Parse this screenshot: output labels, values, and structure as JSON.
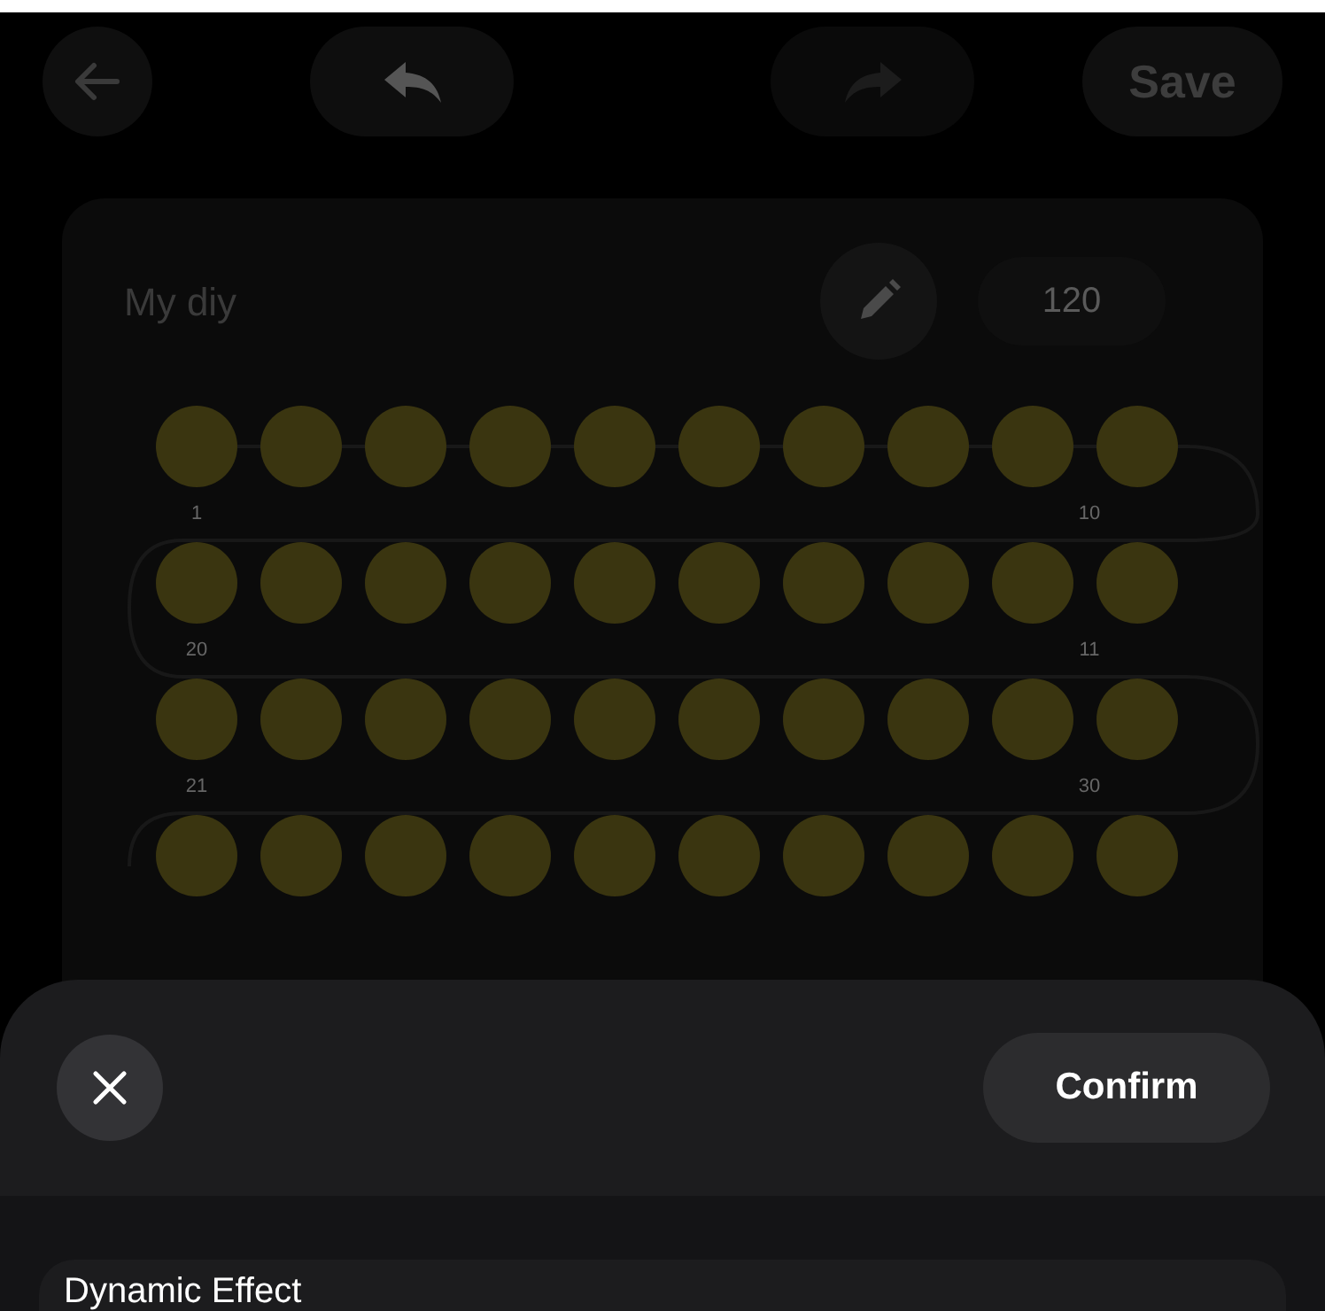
{
  "toolbar": {
    "undo": {
      "disabled": false
    },
    "redo": {
      "disabled": true
    },
    "save_label": "Save"
  },
  "card": {
    "title": "My diy",
    "value": "120",
    "rows": [
      {
        "start_label": "1",
        "end_label": "10"
      },
      {
        "start_label": "20",
        "end_label": "11"
      },
      {
        "start_label": "21",
        "end_label": "30"
      },
      {}
    ]
  },
  "sheet": {
    "confirm_label": "Confirm",
    "section_title": "Dynamic Effect"
  }
}
